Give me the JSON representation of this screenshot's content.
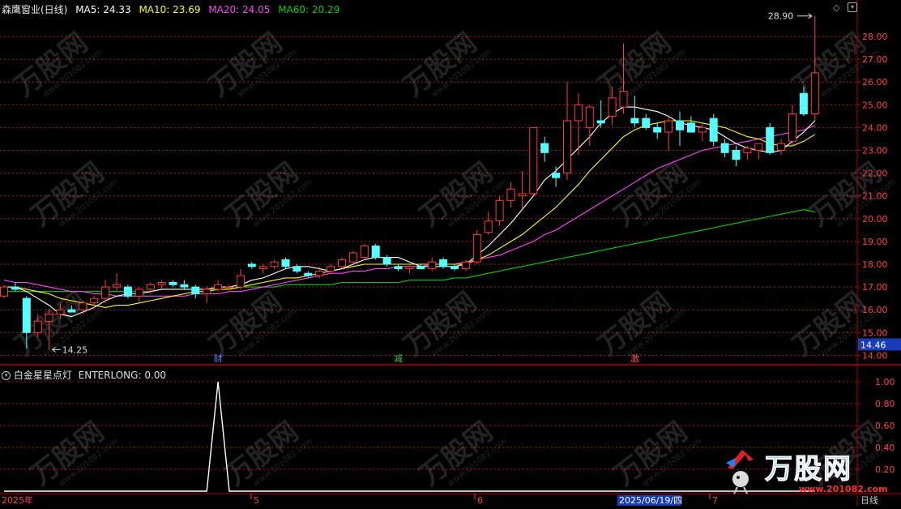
{
  "header": {
    "stock_title": "森鹰窗业(日线)",
    "ma5": "MA5: 24.33",
    "ma10": "MA10: 23.69",
    "ma20": "MA20: 24.05",
    "ma60": "MA60: 20.29"
  },
  "sub_header": {
    "indicator_name": "白金星星点灯",
    "indicator_value": "ENTERLONG: 0.00"
  },
  "axis": {
    "period_label": "日线",
    "price_ticks": [
      "28.00",
      "27.00",
      "26.00",
      "25.00",
      "24.00",
      "23.00",
      "22.00",
      "21.00",
      "20.00",
      "19.00",
      "18.00",
      "17.00",
      "16.00",
      "15.00",
      "14.00"
    ],
    "current_price": "14.46",
    "indicator_ticks": [
      "1.00",
      "0.80",
      "0.60",
      "0.40",
      "0.20"
    ],
    "date_labels": [
      "2025年",
      "5",
      "6",
      "2025/06/19/四",
      "7"
    ]
  },
  "annotations": {
    "high_label": "28.90",
    "low_label": "14.25",
    "markers": [
      "财",
      "减",
      "激"
    ]
  },
  "watermark": {
    "brand": "万股网",
    "url": "www.201082.com"
  },
  "colors": {
    "up": "#ff3b3b",
    "down": "#54ffff",
    "ma5": "#ffffff",
    "ma10": "#ffff00",
    "ma20": "#ff40ff",
    "ma60": "#00d000",
    "grid": "#a02020",
    "axis": "#b00000"
  },
  "chart_data": {
    "type": "candlestick",
    "price_range": [
      14.0,
      28.9
    ],
    "candles": [
      {
        "o": 16.6,
        "h": 17.1,
        "l": 16.5,
        "c": 17.0
      },
      {
        "o": 17.0,
        "h": 17.2,
        "l": 16.8,
        "c": 16.9
      },
      {
        "o": 16.5,
        "h": 16.6,
        "l": 14.3,
        "c": 15.0
      },
      {
        "o": 15.0,
        "h": 15.8,
        "l": 14.8,
        "c": 15.5
      },
      {
        "o": 15.5,
        "h": 16.0,
        "l": 14.25,
        "c": 15.8
      },
      {
        "o": 15.8,
        "h": 16.3,
        "l": 15.6,
        "c": 16.0
      },
      {
        "o": 16.0,
        "h": 16.2,
        "l": 15.9,
        "c": 15.9
      },
      {
        "o": 16.0,
        "h": 16.4,
        "l": 15.8,
        "c": 16.3
      },
      {
        "o": 16.3,
        "h": 16.6,
        "l": 16.1,
        "c": 16.5
      },
      {
        "o": 16.5,
        "h": 17.3,
        "l": 16.3,
        "c": 17.0
      },
      {
        "o": 17.0,
        "h": 17.6,
        "l": 16.8,
        "c": 17.1
      },
      {
        "o": 17.0,
        "h": 17.1,
        "l": 16.5,
        "c": 16.6
      },
      {
        "o": 16.6,
        "h": 17.0,
        "l": 16.3,
        "c": 16.9
      },
      {
        "o": 16.9,
        "h": 17.2,
        "l": 16.7,
        "c": 17.1
      },
      {
        "o": 17.1,
        "h": 17.3,
        "l": 16.9,
        "c": 17.2
      },
      {
        "o": 17.2,
        "h": 17.3,
        "l": 17.0,
        "c": 17.1
      },
      {
        "o": 17.1,
        "h": 17.3,
        "l": 16.9,
        "c": 17.0
      },
      {
        "o": 17.0,
        "h": 17.1,
        "l": 16.5,
        "c": 16.7
      },
      {
        "o": 16.7,
        "h": 17.0,
        "l": 16.3,
        "c": 16.9
      },
      {
        "o": 16.9,
        "h": 17.3,
        "l": 16.8,
        "c": 17.1
      },
      {
        "o": 17.0,
        "h": 17.1,
        "l": 16.9,
        "c": 17.0
      },
      {
        "o": 17.0,
        "h": 17.8,
        "l": 16.9,
        "c": 17.5
      },
      {
        "o": 18.0,
        "h": 18.1,
        "l": 17.8,
        "c": 17.9
      },
      {
        "o": 17.8,
        "h": 18.0,
        "l": 17.6,
        "c": 17.9
      },
      {
        "o": 17.9,
        "h": 18.2,
        "l": 17.8,
        "c": 18.1
      },
      {
        "o": 18.2,
        "h": 18.3,
        "l": 17.8,
        "c": 17.9
      },
      {
        "o": 17.9,
        "h": 18.0,
        "l": 17.6,
        "c": 17.7
      },
      {
        "o": 17.6,
        "h": 17.7,
        "l": 17.4,
        "c": 17.5
      },
      {
        "o": 17.5,
        "h": 17.9,
        "l": 17.4,
        "c": 17.7
      },
      {
        "o": 17.7,
        "h": 18.0,
        "l": 17.6,
        "c": 17.9
      },
      {
        "o": 17.9,
        "h": 18.3,
        "l": 17.8,
        "c": 18.2
      },
      {
        "o": 18.1,
        "h": 18.6,
        "l": 18.0,
        "c": 18.5
      },
      {
        "o": 18.3,
        "h": 18.9,
        "l": 18.2,
        "c": 18.8
      },
      {
        "o": 18.8,
        "h": 18.9,
        "l": 18.2,
        "c": 18.3
      },
      {
        "o": 18.3,
        "h": 18.4,
        "l": 17.9,
        "c": 18.0
      },
      {
        "o": 17.9,
        "h": 18.0,
        "l": 17.7,
        "c": 17.8
      },
      {
        "o": 17.8,
        "h": 18.0,
        "l": 17.6,
        "c": 17.9
      },
      {
        "o": 17.9,
        "h": 18.0,
        "l": 17.8,
        "c": 17.8
      },
      {
        "o": 17.8,
        "h": 18.3,
        "l": 17.7,
        "c": 18.1
      },
      {
        "o": 18.2,
        "h": 18.3,
        "l": 17.8,
        "c": 17.9
      },
      {
        "o": 17.9,
        "h": 18.0,
        "l": 17.7,
        "c": 17.8
      },
      {
        "o": 17.8,
        "h": 18.2,
        "l": 17.7,
        "c": 18.1
      },
      {
        "o": 18.1,
        "h": 19.5,
        "l": 18.0,
        "c": 19.3
      },
      {
        "o": 19.4,
        "h": 20.3,
        "l": 19.3,
        "c": 19.9
      },
      {
        "o": 19.9,
        "h": 21.0,
        "l": 19.7,
        "c": 20.8
      },
      {
        "o": 20.8,
        "h": 21.6,
        "l": 20.5,
        "c": 21.3
      },
      {
        "o": 21.0,
        "h": 22.1,
        "l": 20.4,
        "c": 21.1
      },
      {
        "o": 21.1,
        "h": 24.0,
        "l": 21.0,
        "c": 24.0
      },
      {
        "o": 23.3,
        "h": 23.6,
        "l": 22.5,
        "c": 22.9
      },
      {
        "o": 22.0,
        "h": 22.3,
        "l": 21.4,
        "c": 21.8
      },
      {
        "o": 22.0,
        "h": 26.0,
        "l": 21.7,
        "c": 24.3
      },
      {
        "o": 24.3,
        "h": 25.5,
        "l": 22.8,
        "c": 25.0
      },
      {
        "o": 24.0,
        "h": 25.0,
        "l": 23.2,
        "c": 24.9
      },
      {
        "o": 24.3,
        "h": 25.2,
        "l": 24.0,
        "c": 24.2
      },
      {
        "o": 24.5,
        "h": 25.8,
        "l": 24.1,
        "c": 25.3
      },
      {
        "o": 24.9,
        "h": 27.7,
        "l": 24.6,
        "c": 25.6
      },
      {
        "o": 24.4,
        "h": 25.4,
        "l": 24.0,
        "c": 24.2
      },
      {
        "o": 24.4,
        "h": 24.6,
        "l": 23.9,
        "c": 24.0
      },
      {
        "o": 24.0,
        "h": 24.2,
        "l": 23.5,
        "c": 23.8
      },
      {
        "o": 23.8,
        "h": 24.5,
        "l": 23.0,
        "c": 24.3
      },
      {
        "o": 24.3,
        "h": 24.7,
        "l": 23.2,
        "c": 23.9
      },
      {
        "o": 24.2,
        "h": 24.5,
        "l": 23.8,
        "c": 23.8
      },
      {
        "o": 23.8,
        "h": 24.2,
        "l": 23.4,
        "c": 24.0
      },
      {
        "o": 24.4,
        "h": 24.6,
        "l": 23.2,
        "c": 23.4
      },
      {
        "o": 23.3,
        "h": 23.5,
        "l": 22.7,
        "c": 22.9
      },
      {
        "o": 23.0,
        "h": 23.2,
        "l": 22.3,
        "c": 22.6
      },
      {
        "o": 22.9,
        "h": 23.2,
        "l": 22.6,
        "c": 23.1
      },
      {
        "o": 23.0,
        "h": 23.3,
        "l": 22.6,
        "c": 23.3
      },
      {
        "o": 24.0,
        "h": 24.2,
        "l": 22.8,
        "c": 22.9
      },
      {
        "o": 23.0,
        "h": 23.5,
        "l": 22.8,
        "c": 23.3
      },
      {
        "o": 23.4,
        "h": 25.0,
        "l": 23.2,
        "c": 24.6
      },
      {
        "o": 25.5,
        "h": 25.8,
        "l": 24.5,
        "c": 24.6
      },
      {
        "o": 24.6,
        "h": 28.9,
        "l": 24.3,
        "c": 26.4
      }
    ],
    "ma5": [
      17.0,
      17.0,
      16.8,
      16.5,
      16.2,
      15.8,
      15.7,
      15.9,
      16.1,
      16.4,
      16.6,
      16.7,
      16.7,
      16.8,
      16.9,
      16.9,
      16.9,
      16.9,
      16.9,
      17.0,
      17.0,
      17.1,
      17.3,
      17.4,
      17.6,
      17.8,
      17.9,
      17.9,
      17.8,
      17.7,
      17.8,
      18.0,
      18.2,
      18.3,
      18.3,
      18.3,
      18.1,
      17.9,
      17.9,
      17.9,
      17.9,
      18.0,
      18.4,
      18.8,
      19.3,
      19.8,
      20.4,
      21.0,
      21.7,
      22.1,
      22.6,
      23.1,
      23.6,
      24.2,
      24.6,
      24.9,
      24.9,
      24.8,
      24.7,
      24.5,
      24.2,
      24.1,
      24.0,
      23.9,
      23.6,
      23.3,
      23.1,
      23.0,
      22.9,
      23.0,
      23.4,
      23.8,
      24.3
    ],
    "ma10": [
      17.0,
      17.0,
      16.9,
      16.8,
      16.7,
      16.5,
      16.4,
      16.3,
      16.2,
      16.1,
      16.2,
      16.2,
      16.3,
      16.4,
      16.5,
      16.6,
      16.7,
      16.8,
      16.8,
      16.9,
      16.9,
      17.0,
      17.1,
      17.2,
      17.3,
      17.4,
      17.4,
      17.5,
      17.6,
      17.7,
      17.8,
      17.9,
      18.0,
      18.0,
      18.0,
      18.0,
      18.0,
      18.0,
      18.0,
      18.0,
      18.0,
      18.0,
      18.2,
      18.4,
      18.7,
      19.0,
      19.3,
      19.7,
      20.1,
      20.5,
      21.0,
      21.5,
      22.1,
      22.6,
      23.1,
      23.6,
      23.9,
      24.1,
      24.2,
      24.3,
      24.3,
      24.3,
      24.2,
      24.1,
      24.0,
      23.8,
      23.6,
      23.5,
      23.3,
      23.2,
      23.2,
      23.4,
      23.7
    ],
    "ma20": [
      17.3,
      17.2,
      17.2,
      17.1,
      17.0,
      16.9,
      16.8,
      16.8,
      16.7,
      16.7,
      16.6,
      16.6,
      16.6,
      16.6,
      16.6,
      16.6,
      16.6,
      16.7,
      16.7,
      16.7,
      16.8,
      16.8,
      16.9,
      17.0,
      17.1,
      17.2,
      17.3,
      17.4,
      17.5,
      17.6,
      17.6,
      17.7,
      17.7,
      17.8,
      17.8,
      17.9,
      17.9,
      17.9,
      18.0,
      18.0,
      18.0,
      18.1,
      18.2,
      18.3,
      18.4,
      18.6,
      18.8,
      19.0,
      19.3,
      19.5,
      19.8,
      20.1,
      20.4,
      20.7,
      21.0,
      21.3,
      21.6,
      21.9,
      22.2,
      22.4,
      22.6,
      22.8,
      23.0,
      23.1,
      23.2,
      23.3,
      23.4,
      23.5,
      23.6,
      23.7,
      23.8,
      23.9,
      24.1
    ],
    "ma60": [
      16.8,
      16.8,
      16.8,
      16.8,
      16.8,
      16.8,
      16.8,
      16.8,
      16.8,
      16.8,
      16.8,
      16.8,
      16.8,
      16.8,
      16.9,
      16.9,
      16.9,
      16.9,
      16.9,
      16.9,
      16.9,
      17.0,
      17.0,
      17.0,
      17.0,
      17.1,
      17.1,
      17.1,
      17.1,
      17.1,
      17.2,
      17.2,
      17.2,
      17.2,
      17.2,
      17.2,
      17.3,
      17.3,
      17.3,
      17.3,
      17.4,
      17.4,
      17.5,
      17.6,
      17.7,
      17.8,
      17.9,
      18.0,
      18.1,
      18.2,
      18.3,
      18.4,
      18.5,
      18.6,
      18.7,
      18.8,
      18.9,
      19.0,
      19.1,
      19.2,
      19.3,
      19.4,
      19.5,
      19.6,
      19.7,
      19.8,
      19.9,
      20.0,
      20.1,
      20.2,
      20.3,
      20.4,
      20.3
    ],
    "indicator": [
      0,
      0,
      0,
      0,
      0,
      0,
      0,
      0,
      0,
      0,
      0,
      0,
      0,
      0,
      0,
      0,
      0,
      0,
      0,
      1,
      0,
      0,
      0,
      0,
      0,
      0,
      0,
      0,
      0,
      0,
      0,
      0,
      0,
      0,
      0,
      0,
      0,
      0,
      0,
      0,
      0,
      0,
      0,
      0,
      0,
      0,
      0,
      0,
      0,
      0,
      0,
      0,
      0,
      0,
      0,
      0,
      0,
      0,
      0,
      0,
      0,
      0,
      0,
      0,
      0,
      0,
      0,
      0,
      0,
      0,
      0,
      0,
      0
    ],
    "indicator_range": [
      0,
      1.0
    ]
  }
}
